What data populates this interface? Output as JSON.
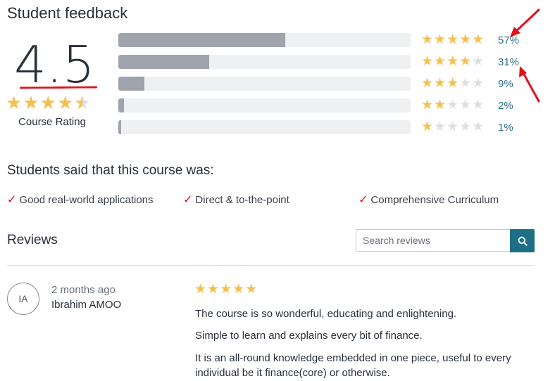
{
  "feedback": {
    "title": "Student feedback",
    "average": "4.5",
    "average_stars": 4.5,
    "rating_label": "Course Rating",
    "distribution": [
      {
        "stars": 5,
        "percent_label": "57%",
        "percent": 57
      },
      {
        "stars": 4,
        "percent_label": "31%",
        "percent": 31
      },
      {
        "stars": 3,
        "percent_label": "9%",
        "percent": 9
      },
      {
        "stars": 2,
        "percent_label": "2%",
        "percent": 2
      },
      {
        "stars": 1,
        "percent_label": "1%",
        "percent": 1
      }
    ]
  },
  "students_said": {
    "title": "Students said that this course was:",
    "items": [
      "Good real-world applications",
      "Direct & to-the-point",
      "Comprehensive Curriculum"
    ]
  },
  "reviews": {
    "title": "Reviews",
    "search_placeholder": "Search reviews",
    "items": [
      {
        "initials": "IA",
        "time": "2 months ago",
        "author": "Ibrahim AMOO",
        "rating": 5,
        "lines": [
          "The course is so wonderful, educating and enlightening.",
          "Simple to learn and explains every bit of finance.",
          "It is an all-round knowledge embedded in one piece, useful to every individual be it finance(core) or otherwise."
        ]
      }
    ]
  },
  "colors": {
    "star_filled": "#f4c150",
    "star_empty": "#dedfe0",
    "bar_fill": "#9fa3ac",
    "bar_track": "#eff0f1",
    "percent_link": "#2d6f8c",
    "search_button": "#1d6f88",
    "annotation_red": "#e0101a"
  },
  "icons": {
    "check": "check-icon",
    "search": "search-icon",
    "star": "star-icon"
  }
}
